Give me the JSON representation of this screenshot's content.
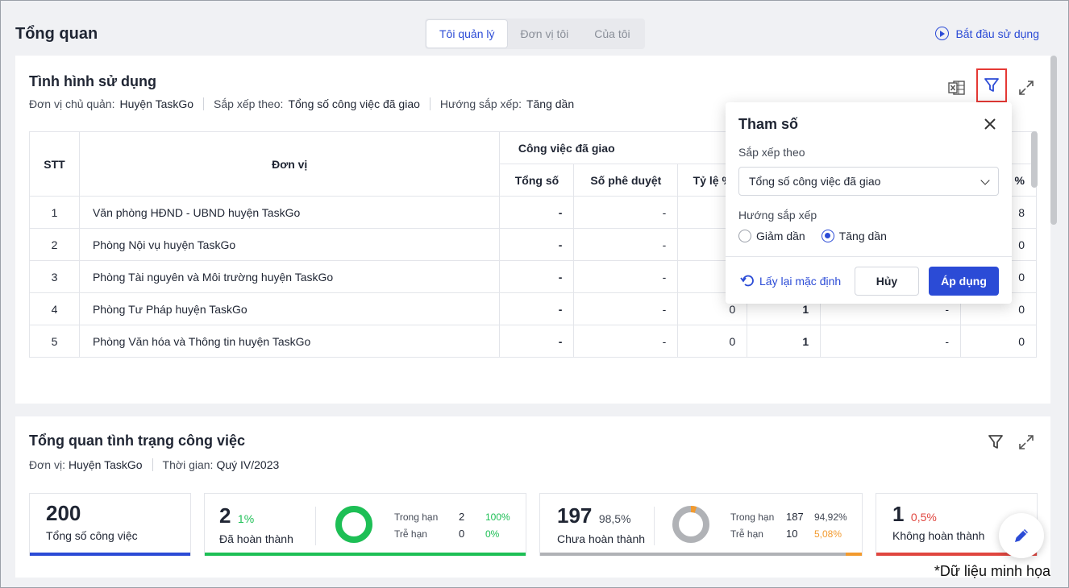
{
  "header": {
    "title": "Tổng quan",
    "tabs": [
      {
        "label": "Tôi quản lý",
        "active": true
      },
      {
        "label": "Đơn vị tôi",
        "active": false
      },
      {
        "label": "Của tôi",
        "active": false
      }
    ],
    "start_link": "Bắt đầu sử dụng"
  },
  "usage": {
    "title": "Tình hình sử dụng",
    "meta": {
      "unit_label": "Đơn vị chủ quản:",
      "unit_value": "Huyện TaskGo",
      "sort_label": "Sắp xếp theo:",
      "sort_value": "Tổng số công việc đã giao",
      "dir_label": "Hướng sắp xếp:",
      "dir_value": "Tăng dần"
    },
    "table": {
      "col_stt": "STT",
      "col_unit": "Đơn vị",
      "group_assigned": "Công việc đã giao",
      "sub_total": "Tổng số",
      "sub_approved": "Số phê duyệt",
      "sub_rate": "Tỷ lệ %",
      "sub_last": "%",
      "rows": [
        {
          "stt": "1",
          "unit": "Văn phòng HĐND - UBND huyện TaskGo",
          "total": "-",
          "approved": "-",
          "rate": "",
          "c5": "",
          "c6": "",
          "c7": "8"
        },
        {
          "stt": "2",
          "unit": "Phòng Nội vụ huyện TaskGo",
          "total": "-",
          "approved": "-",
          "rate": "",
          "c5": "",
          "c6": "",
          "c7": "0"
        },
        {
          "stt": "3",
          "unit": "Phòng Tài nguyên và Môi trường huyện TaskGo",
          "total": "-",
          "approved": "-",
          "rate": "",
          "c5": "",
          "c6": "",
          "c7": "0"
        },
        {
          "stt": "4",
          "unit": "Phòng Tư Pháp huyện TaskGo",
          "total": "-",
          "approved": "-",
          "rate": "0",
          "c5": "1",
          "c6": "-",
          "c7": "0"
        },
        {
          "stt": "5",
          "unit": "Phòng Văn hóa và Thông tin huyện TaskGo",
          "total": "-",
          "approved": "-",
          "rate": "0",
          "c5": "1",
          "c6": "-",
          "c7": "0"
        }
      ]
    }
  },
  "popup": {
    "title": "Tham số",
    "sort_label": "Sắp xếp theo",
    "sort_value": "Tổng số công việc đã giao",
    "dir_label": "Hướng sắp xếp",
    "dir_options": [
      {
        "label": "Giảm dần",
        "selected": false
      },
      {
        "label": "Tăng dần",
        "selected": true
      }
    ],
    "reset_label": "Lấy lại mặc định",
    "cancel_label": "Hủy",
    "apply_label": "Áp dụng"
  },
  "status": {
    "title": "Tổng quan tình trạng công việc",
    "unit_label": "Đơn vị:",
    "unit_value": "Huyện TaskGo",
    "time_label": "Thời gian:",
    "time_value": "Quý IV/2023",
    "total": {
      "value": "200",
      "label": "Tổng số công việc",
      "color": "#2b4bd6"
    },
    "done": {
      "value": "2",
      "pct": "1%",
      "label": "Đã hoàn thành",
      "color": "#1dbf55",
      "ontime_label": "Trong hạn",
      "ontime_value": "2",
      "ontime_pct": "100%",
      "late_label": "Trễ hạn",
      "late_value": "0",
      "late_pct": "0%",
      "ontime_fraction": 1.0
    },
    "pending": {
      "value": "197",
      "pct": "98,5%",
      "label": "Chưa hoàn thành",
      "color": "#b0b2b6",
      "ontime_label": "Trong hạn",
      "ontime_value": "187",
      "ontime_pct": "94,92%",
      "late_label": "Trễ hạn",
      "late_value": "10",
      "late_pct": "5,08%",
      "late_color": "#f29a2e",
      "late_fraction": 0.0508
    },
    "failed": {
      "value": "1",
      "pct": "0,5%",
      "label": "Không hoàn thành",
      "color": "#e0463f"
    }
  },
  "footnote": "*Dữ liệu minh họa"
}
